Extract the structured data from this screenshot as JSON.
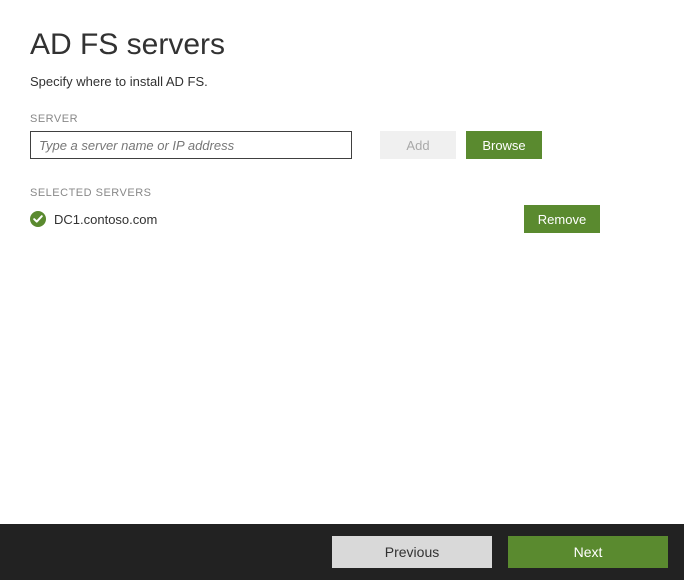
{
  "page": {
    "title": "AD FS servers",
    "subtitle": "Specify where to install AD FS.",
    "server_label": "SERVER",
    "server_placeholder": "Type a server name or IP address",
    "add_label": "Add",
    "browse_label": "Browse",
    "selected_label": "SELECTED SERVERS",
    "remove_label": "Remove"
  },
  "selected_servers": [
    {
      "name": "DC1.contoso.com"
    }
  ],
  "footer": {
    "previous": "Previous",
    "next": "Next"
  },
  "colors": {
    "accent": "#5a8a2f",
    "footer_bg": "#222222"
  }
}
